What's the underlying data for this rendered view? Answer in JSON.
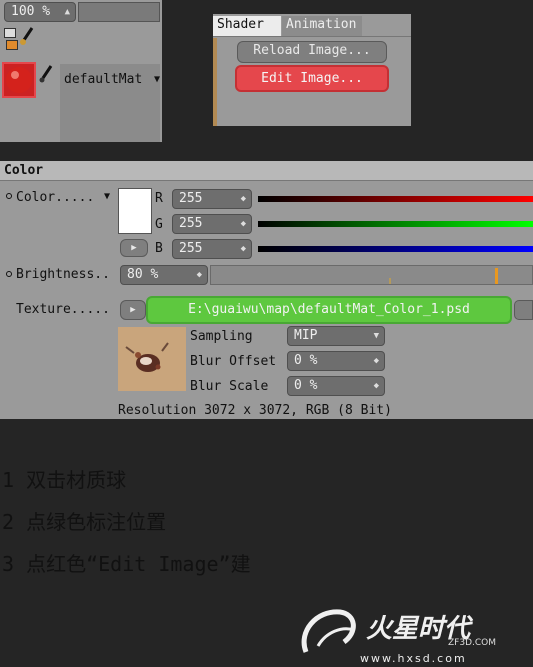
{
  "material_manager": {
    "zoom_value": "100 %",
    "material_name": "defaultMat"
  },
  "tabs": {
    "shader": "Shader",
    "animation": "Animation"
  },
  "buttons": {
    "reload_image": "Reload Image...",
    "edit_image": "Edit Image..."
  },
  "color_section": {
    "header": "Color",
    "color_label": "Color.....",
    "r_label": "R",
    "g_label": "G",
    "b_label": "B",
    "r_value": "255",
    "g_value": "255",
    "b_value": "255",
    "brightness_label": "Brightness..",
    "brightness_value": "80 %",
    "texture_label": "Texture.....",
    "texture_path": "E:\\guaiwu\\map\\defaultMat_Color_1.psd",
    "sampling_label": "Sampling",
    "sampling_value": "MIP",
    "blur_offset_label": "Blur Offset",
    "blur_offset_value": "0 %",
    "blur_scale_label": "Blur Scale",
    "blur_scale_value": "0 %",
    "resolution": "Resolution 3072 x 3072, RGB (8 Bit)"
  },
  "colors": {
    "highlight_red": "#e5474c",
    "highlight_green": "#5ec83f"
  },
  "instructions": [
    "1 双击材质球",
    "2 点绿色标注位置",
    "3 点红色“Edit Image”建"
  ],
  "watermark": {
    "brand": "火星时代",
    "domain": "ZF3D.COM",
    "url": "www.hxsd.com"
  }
}
